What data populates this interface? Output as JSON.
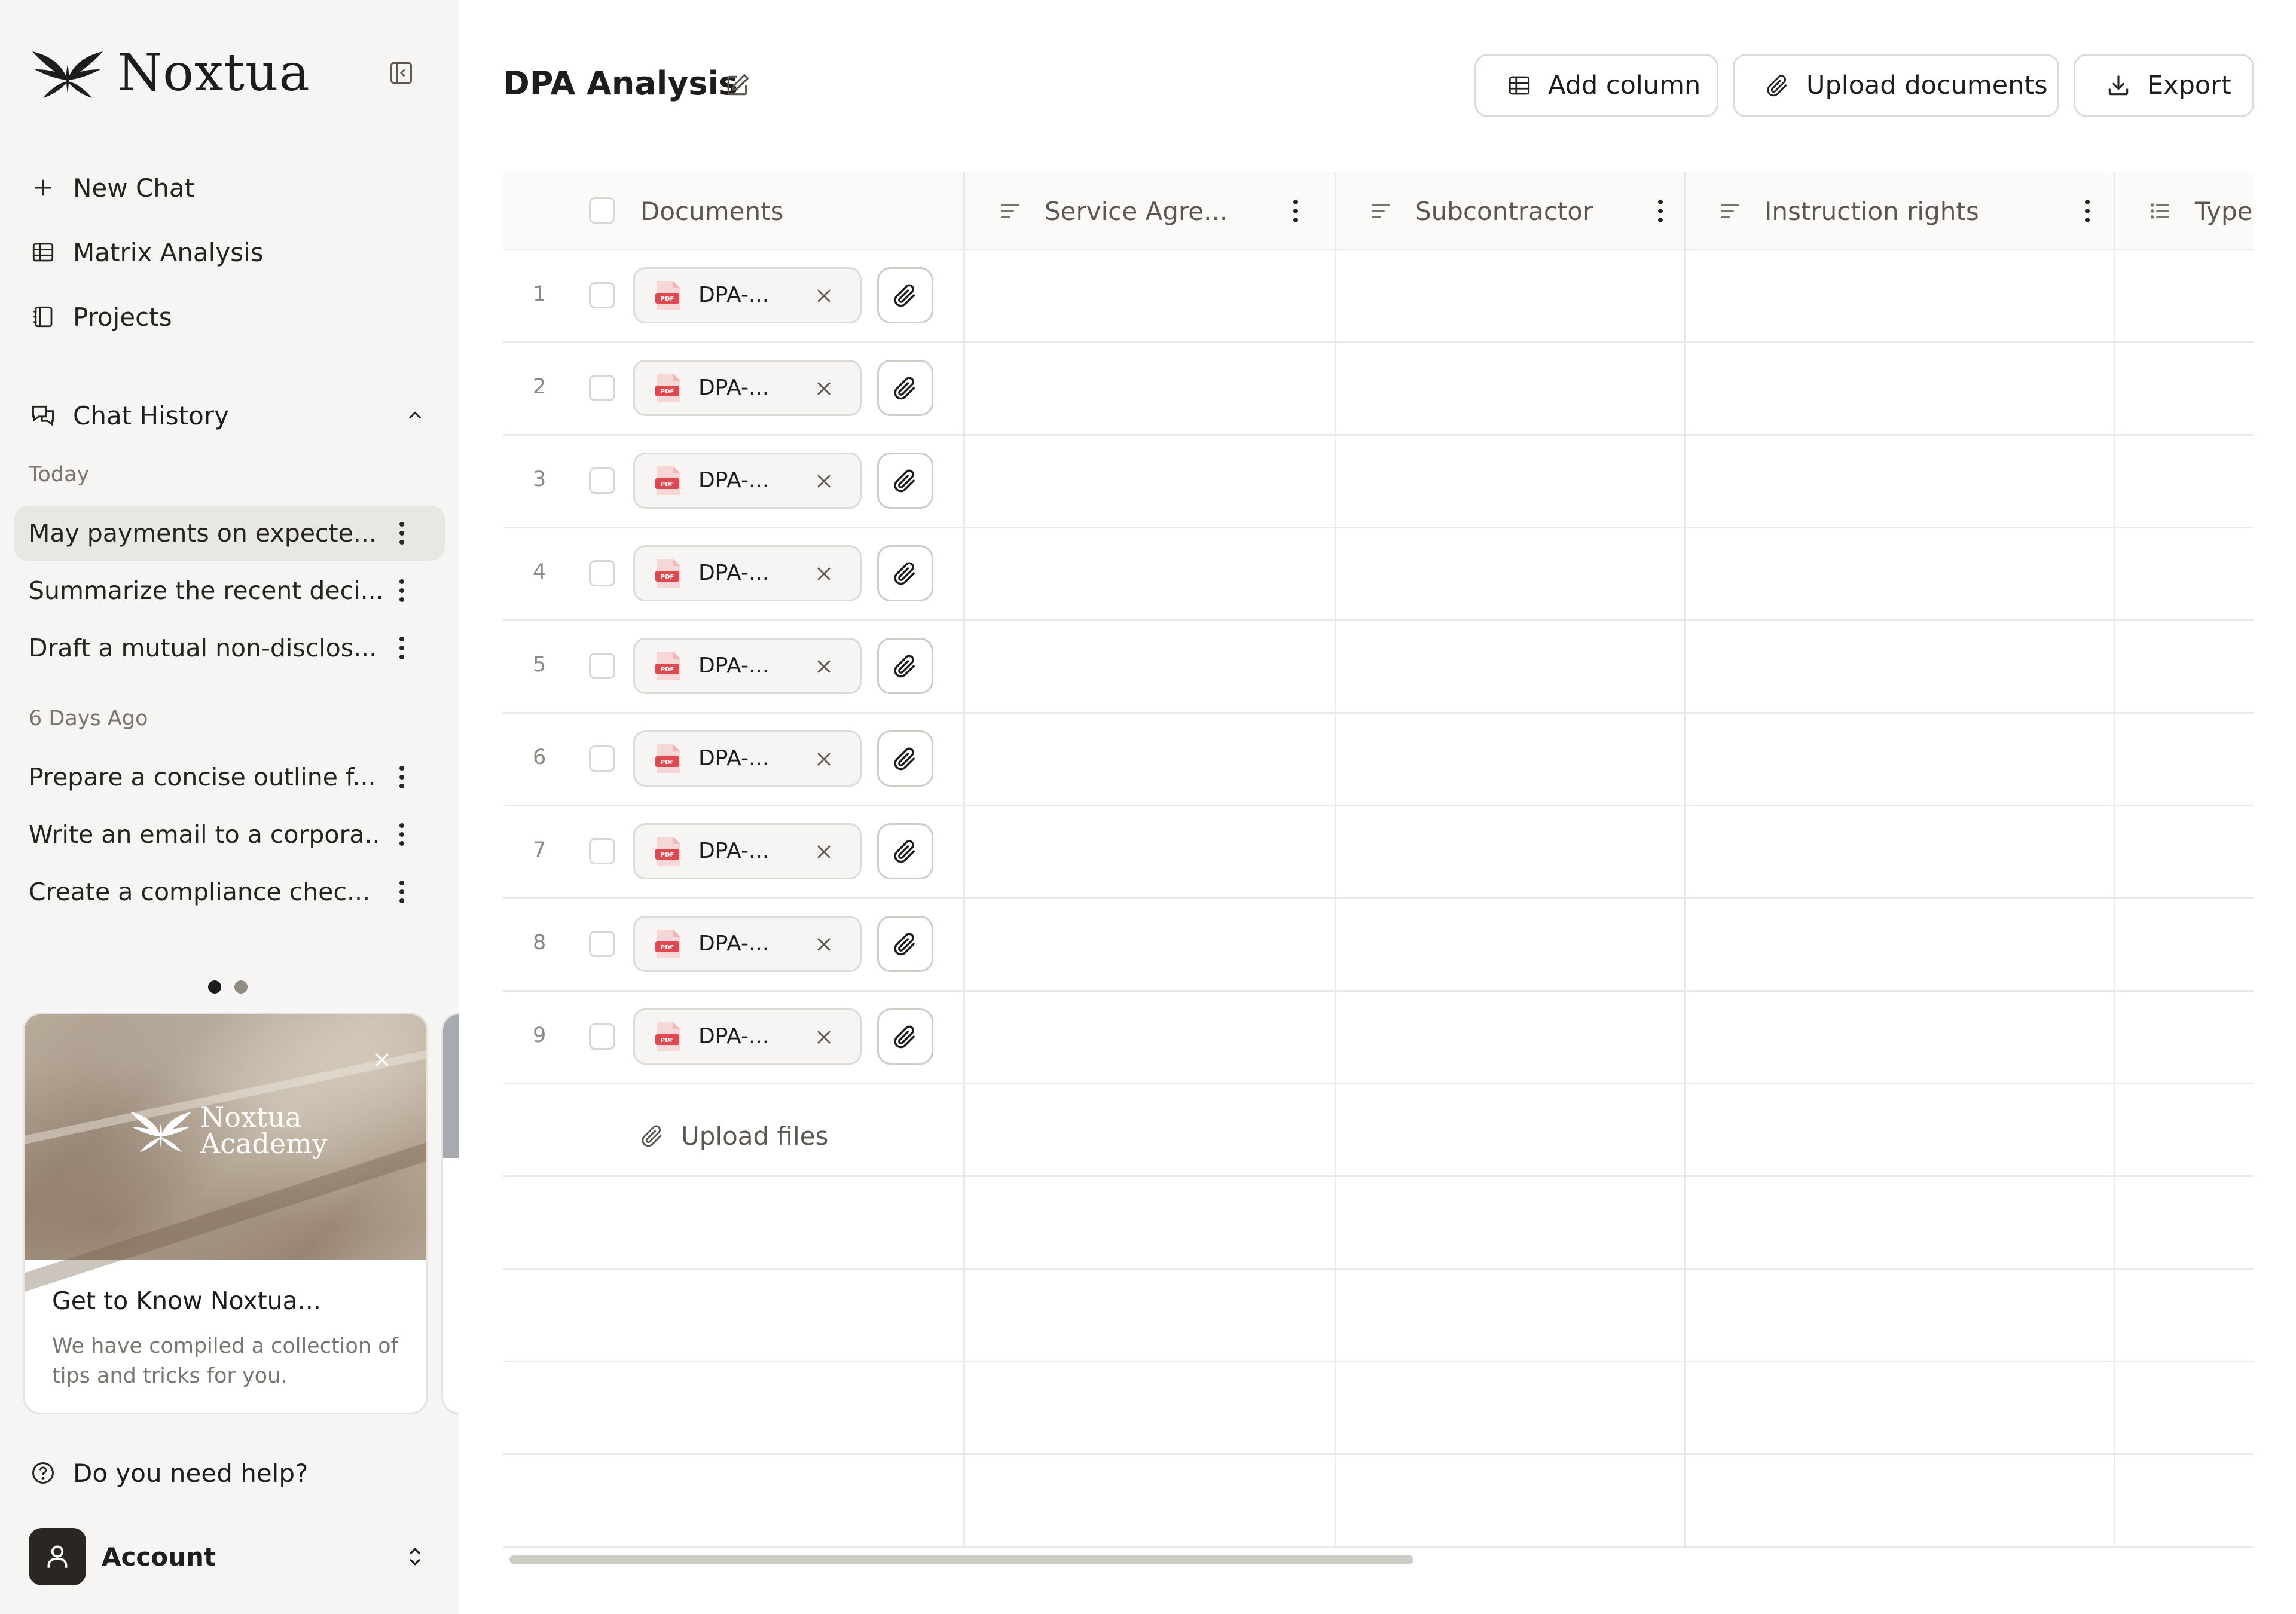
{
  "app": {
    "name": "Noxtua"
  },
  "sidebar": {
    "nav": [
      {
        "label": "New Chat",
        "icon": "plus-icon"
      },
      {
        "label": "Matrix Analysis",
        "icon": "table-icon"
      },
      {
        "label": "Projects",
        "icon": "notebook-icon"
      }
    ],
    "chat_history": {
      "label": "Chat History",
      "groups": [
        {
          "label": "Today",
          "items": [
            {
              "title": "May payments on expecte...",
              "active": true
            },
            {
              "title": "Summarize the recent deci...",
              "active": false
            },
            {
              "title": "Draft a mutual non-disclos...",
              "active": false
            }
          ]
        },
        {
          "label": "6 Days Ago",
          "items": [
            {
              "title": "Prepare a concise outline f...",
              "active": false
            },
            {
              "title": "Write an email to a corpora...",
              "active": false
            },
            {
              "title": "Create a compliance chec...",
              "active": false
            }
          ]
        }
      ]
    },
    "carousel": {
      "pages": 2,
      "current": 1
    },
    "promo": {
      "logo_line1": "Noxtua",
      "logo_line2": "Academy",
      "title": "Get to Know Noxtua...",
      "description": "We have compiled a collection of tips and tricks for you."
    },
    "help_label": "Do you need help?",
    "account_label": "Account"
  },
  "main": {
    "title": "DPA Analysis",
    "toolbar": {
      "add_column": "Add column",
      "upload_documents": "Upload documents",
      "export": "Export"
    },
    "table": {
      "columns": [
        {
          "label": "Documents"
        },
        {
          "label": "Service Agre..."
        },
        {
          "label": "Subcontractor"
        },
        {
          "label": "Instruction rights"
        },
        {
          "label": "Type"
        }
      ],
      "rows": [
        {
          "num": "1",
          "doc": "DPA-..."
        },
        {
          "num": "2",
          "doc": "DPA-..."
        },
        {
          "num": "3",
          "doc": "DPA-..."
        },
        {
          "num": "4",
          "doc": "DPA-..."
        },
        {
          "num": "5",
          "doc": "DPA-..."
        },
        {
          "num": "6",
          "doc": "DPA-..."
        },
        {
          "num": "7",
          "doc": "DPA-..."
        },
        {
          "num": "8",
          "doc": "DPA-..."
        },
        {
          "num": "9",
          "doc": "DPA-..."
        }
      ],
      "upload_files": "Upload files",
      "pdf_badge": "PDF"
    }
  },
  "colors": {
    "sidebar_bg": "#f6f5f3",
    "active_item_bg": "#e9e7e3",
    "border": "#dedbd6",
    "pdf_red": "#e0484f",
    "text": "#1f1d1b",
    "muted": "#7a756f"
  }
}
